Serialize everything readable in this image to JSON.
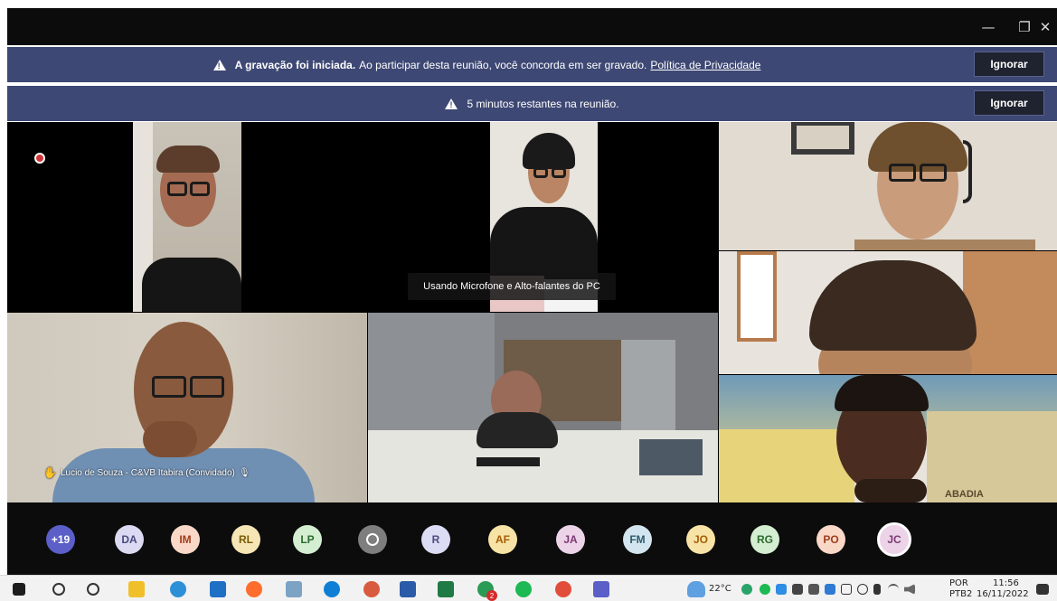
{
  "window": {
    "minimize_glyph": "—",
    "maximize_glyph": "❐",
    "close_glyph": "✕"
  },
  "banners": [
    {
      "bold": "A gravação foi iniciada.",
      "text": "Ao participar desta reunião, você concorda em ser gravado.",
      "link": "Política de Privacidade",
      "button": "Ignorar"
    },
    {
      "text": "5 minutos restantes na reunião.",
      "button": "Ignorar"
    }
  ],
  "tiles": {
    "speaker_name": "Lucio de Souza - C&VB Itabira (Convidado)",
    "audio_tooltip": "Usando Microfone e Alto-falantes do PC",
    "abadia_sign": "ABADIA"
  },
  "roster": [
    {
      "initials": "+19",
      "bg": "#5b5fc7",
      "fg": "#ffffff"
    },
    {
      "initials": "DA",
      "bg": "#dcd9f2",
      "fg": "#4b4b7d"
    },
    {
      "initials": "IM",
      "bg": "#f9d8c8",
      "fg": "#a13d1c"
    },
    {
      "initials": "RL",
      "bg": "#f7e6b5",
      "fg": "#7a5a06"
    },
    {
      "initials": "LP",
      "bg": "#d4eed1",
      "fg": "#2c6b2e"
    },
    {
      "initials": "",
      "bg": "#7e7e7e",
      "fg": "#ffffff",
      "icon": "person-icon"
    },
    {
      "initials": "R",
      "bg": "#dcdcf4",
      "fg": "#4b4b7d"
    },
    {
      "initials": "AF",
      "bg": "#f7e3a5",
      "fg": "#a55c06"
    },
    {
      "initials": "JA",
      "bg": "#ecd3e8",
      "fg": "#7b3a73"
    },
    {
      "initials": "FM",
      "bg": "#d3e6ef",
      "fg": "#2c5a6b"
    },
    {
      "initials": "JO",
      "bg": "#f7e3a5",
      "fg": "#a55c06"
    },
    {
      "initials": "RG",
      "bg": "#d4eed1",
      "fg": "#2c6b2e"
    },
    {
      "initials": "PO",
      "bg": "#f9d8c8",
      "fg": "#a13d1c"
    },
    {
      "initials": "JC",
      "bg": "#ecd3e8",
      "fg": "#7b3a73",
      "selected": true
    }
  ],
  "taskbar": {
    "weather": "22°C",
    "lang_top": "POR",
    "lang_bottom": "PTB2",
    "time": "11:56",
    "date": "16/11/2022",
    "teams_badge": "2"
  }
}
